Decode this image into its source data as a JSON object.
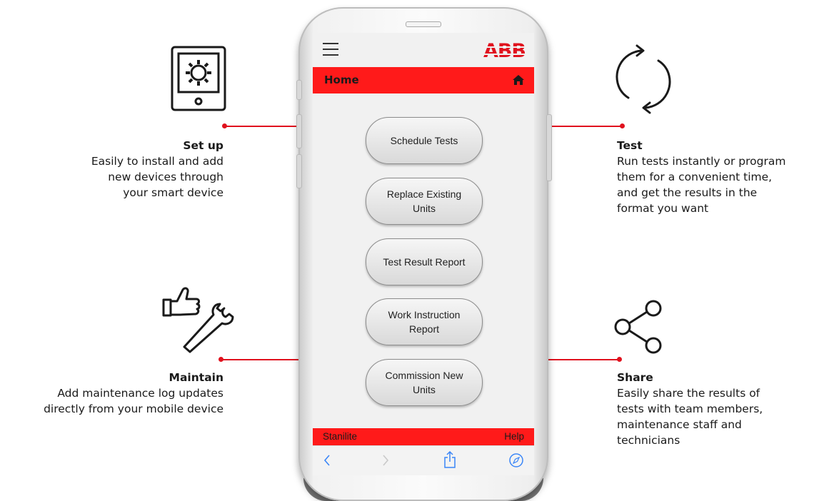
{
  "features": {
    "setup": {
      "title": "Set up",
      "description": "Easily to install and add\nnew devices through\nyour smart device",
      "icon": "tablet-gear-icon"
    },
    "maintain": {
      "title": "Maintain",
      "description": "Add maintenance log updates\ndirectly from your mobile device",
      "icon": "thumbs-up-wrench-icon"
    },
    "test": {
      "title": "Test",
      "description": "Run tests instantly or program\nthem for a convenient time,\nand get the results in the\nformat you want",
      "icon": "refresh-cycle-icon"
    },
    "share": {
      "title": "Share",
      "description": "Easily share the results of\ntests with team members,\nmaintenance staff and\ntechnicians",
      "icon": "share-nodes-icon"
    }
  },
  "app": {
    "logo": "ABB",
    "header_title": "Home",
    "buttons": [
      "Schedule Tests",
      "Replace Existing\nUnits",
      "Test Result Report",
      "Work Instruction\nReport",
      "Commission New\nUnits"
    ],
    "footer_left": "Stanilite",
    "footer_right": "Help"
  },
  "colors": {
    "accent": "#e0121e",
    "header_bar": "#ff1a1a",
    "ios_blue": "#3b86f7"
  }
}
